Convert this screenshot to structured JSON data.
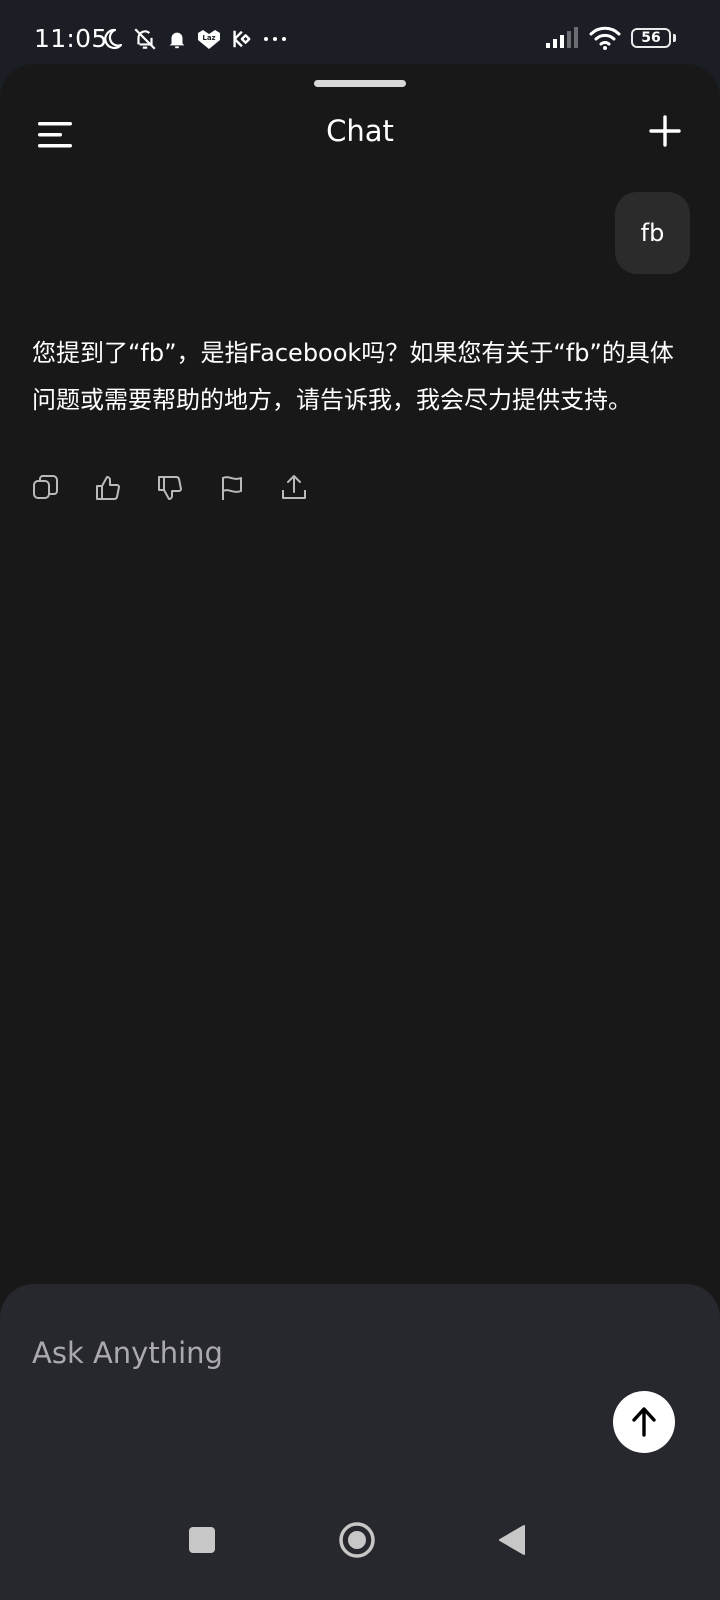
{
  "status_bar": {
    "time": "11:05",
    "battery_level": "56",
    "icons": [
      "moon-icon",
      "bell-off-icon",
      "bell-icon",
      "lazada-icon",
      "kucoin-icon",
      "more-dots-icon",
      "signal-icon",
      "wifi-icon",
      "battery-icon"
    ]
  },
  "header": {
    "title": "Chat",
    "menu_icon": "menu-icon",
    "new_chat_icon": "plus-icon"
  },
  "conversation": {
    "user_message": "fb",
    "assistant_message": "您提到了“fb”，是指Facebook吗？如果您有关于“fb”的具体问题或需要帮助的地方，请告诉我，我会尽力提供支持。",
    "actions": [
      "copy-icon",
      "thumbs-up-icon",
      "thumbs-down-icon",
      "flag-icon",
      "share-icon"
    ]
  },
  "composer": {
    "placeholder": "Ask Anything",
    "value": "",
    "send_icon": "arrow-up-icon"
  },
  "nav": {
    "icons": [
      "recents-square-icon",
      "home-circle-icon",
      "back-triangle-icon"
    ]
  },
  "colors": {
    "status_bg": "#1b1e24",
    "sheet_bg": "#181818",
    "bubble_bg": "#2b2b2b",
    "composer_bg": "#27282d",
    "text": "#ffffff",
    "muted": "#a9a9ae"
  }
}
